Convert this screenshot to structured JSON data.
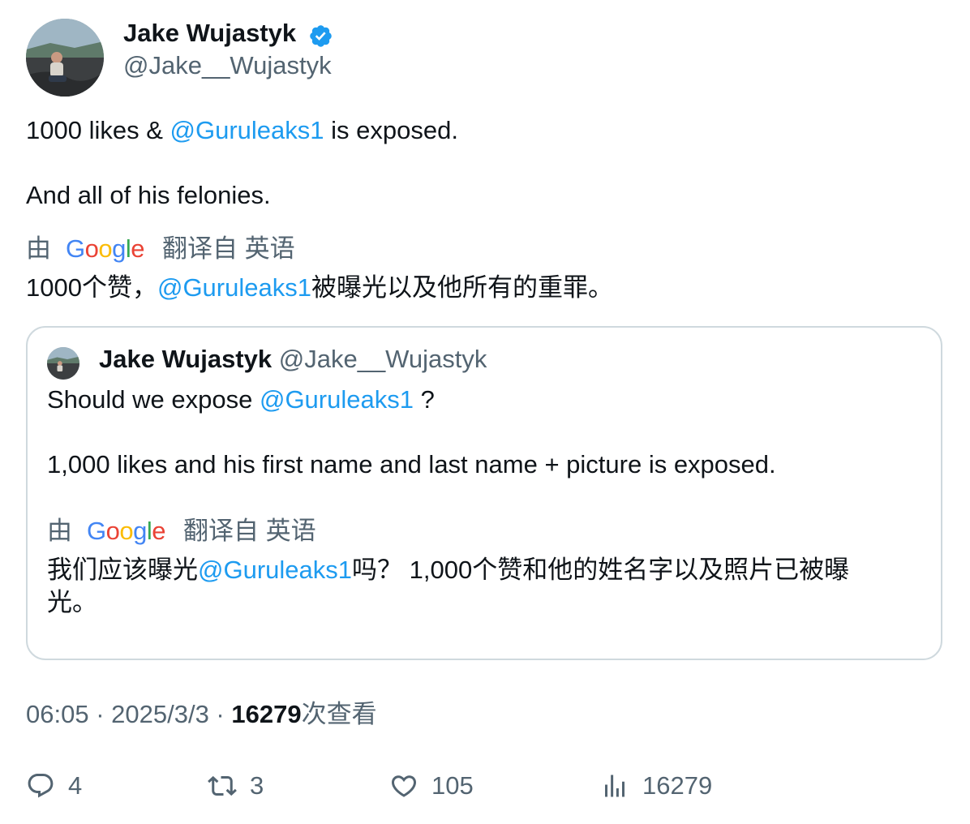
{
  "author": {
    "display_name": "Jake Wujastyk",
    "handle": "@Jake__Wujastyk",
    "verified": true,
    "verified_icon": "verified-badge-icon"
  },
  "tweet": {
    "line1_prefix": "1000 likes & ",
    "line1_mention": "@Guruleaks1",
    "line1_suffix": " is exposed.",
    "line2": "And all of his felonies.",
    "translation": {
      "by_label": "由",
      "google": [
        "G",
        "o",
        "o",
        "g",
        "l",
        "e"
      ],
      "translated_from": "翻译自 英语",
      "text_prefix": "1000个赞，",
      "text_mention": "@Guruleaks1",
      "text_suffix": "被曝光以及他所有的重罪。"
    }
  },
  "quoted_tweet": {
    "display_name": "Jake Wujastyk",
    "handle": "@Jake__Wujastyk",
    "line1_prefix": "Should we expose ",
    "line1_mention": "@Guruleaks1",
    "line1_suffix": " ?",
    "line2": "1,000 likes and his first name and last name + picture is exposed.",
    "translation": {
      "by_label": "由",
      "translated_from": "翻译自 英语",
      "text_prefix": "我们应该曝光",
      "text_mention": "@Guruleaks1",
      "text_suffix": "吗？ 1,000个赞和他的姓名字以及照片已被曝",
      "text_line2": "光。"
    }
  },
  "meta": {
    "time": "06:05",
    "separator": " · ",
    "date": "2025/3/3",
    "views_count": "16279",
    "views_label": "次查看"
  },
  "actions": {
    "reply_count": "4",
    "retweet_count": "3",
    "like_count": "105",
    "views_count": "16279",
    "colors": {
      "muted": "#536471",
      "link": "#1d9bf0",
      "verified": "#1d9bf0"
    }
  }
}
